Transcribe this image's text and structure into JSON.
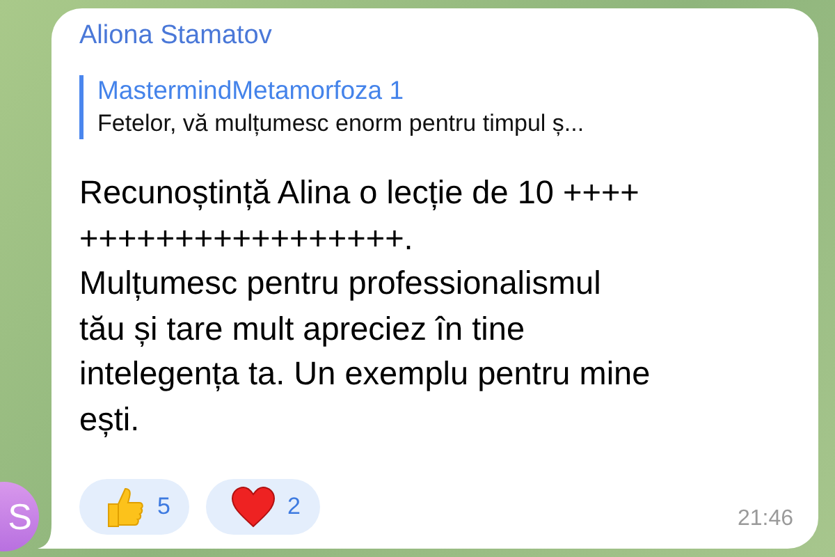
{
  "message": {
    "sender": "Aliona Stamatov",
    "reply": {
      "title": "MastermindMetamorfoza 1",
      "text": "Fetelor, vă mulțumesc enorm pentru timpul ș..."
    },
    "text": "Recunoștință Alina o lecție de 10 ++++\n+++++++++++++++++.\nMulțumesc pentru professionalismul\ntău și tare mult apreciez în tine\nintelegența ta. Un exemplu pentru mine\nești.",
    "reactions": [
      {
        "kind": "thumbs",
        "count": "5"
      },
      {
        "kind": "heart",
        "count": "2"
      }
    ],
    "time": "21:46"
  },
  "avatar": {
    "initial": "S"
  }
}
